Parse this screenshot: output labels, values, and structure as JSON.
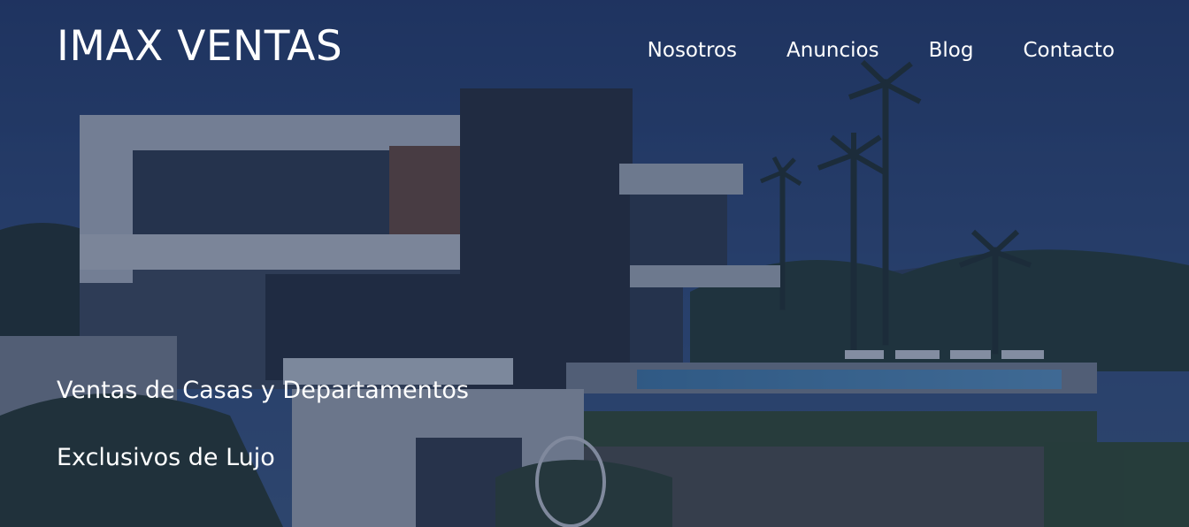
{
  "brand": {
    "title": "IMAX VENTAS"
  },
  "nav": {
    "items": [
      {
        "label": "Nosotros"
      },
      {
        "label": "Anuncios"
      },
      {
        "label": "Blog"
      },
      {
        "label": "Contacto"
      }
    ]
  },
  "hero": {
    "line1": "Ventas de Casas y Departamentos",
    "line2": "Exclusivos de Lujo",
    "image": "modern-villa-at-dusk-image",
    "overlay_color": "#1e2d50"
  }
}
